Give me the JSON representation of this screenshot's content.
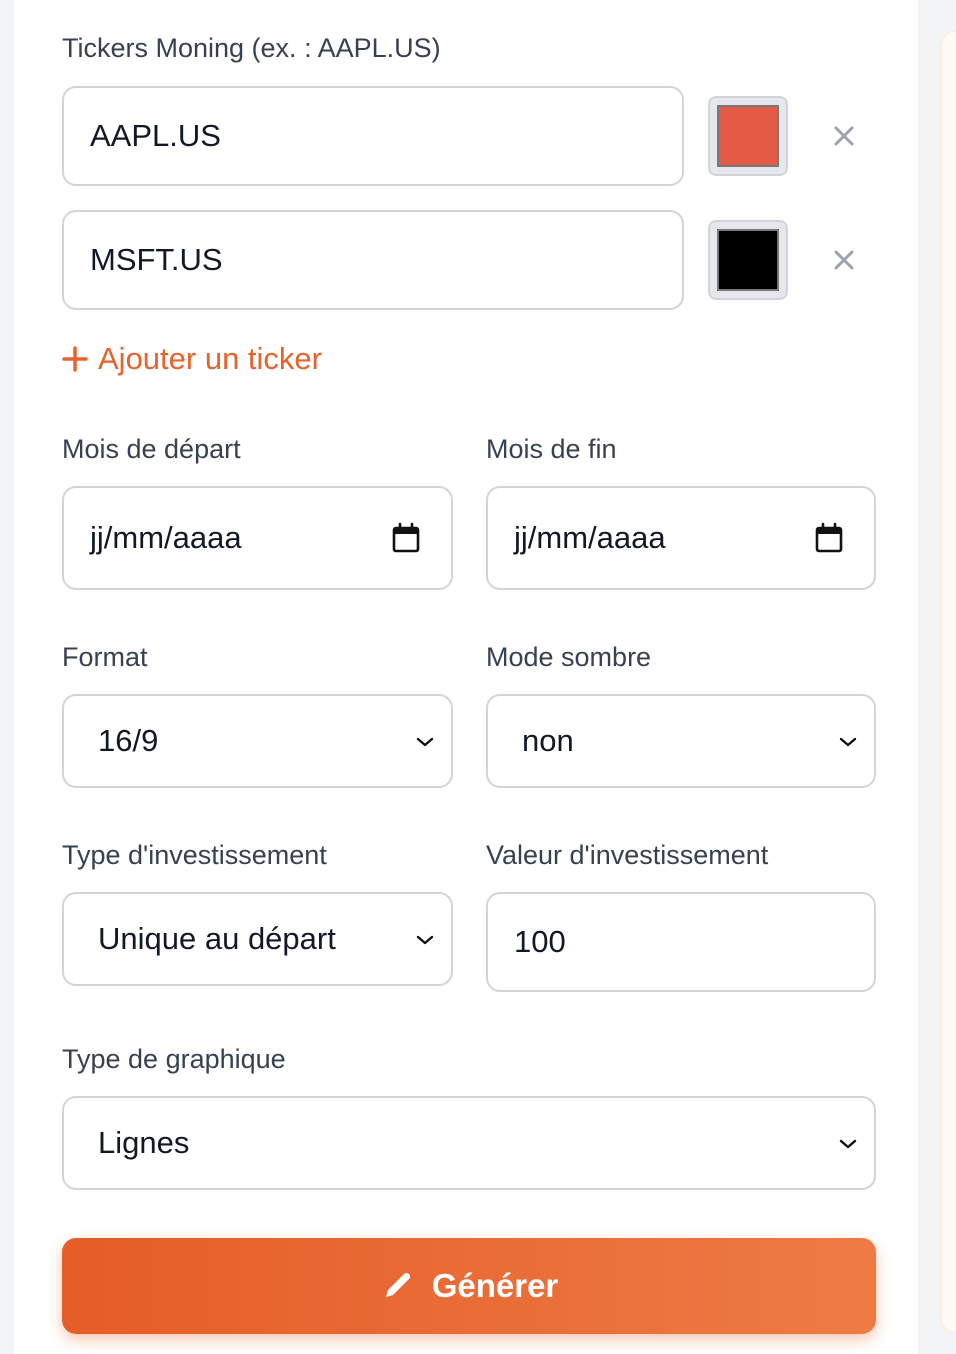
{
  "tickers": {
    "label": "Tickers Moning (ex. : AAPL.US)",
    "items": [
      {
        "value": "AAPL.US",
        "color": "#e45a43"
      },
      {
        "value": "MSFT.US",
        "color": "#000000"
      }
    ],
    "remove_icon": "close-icon",
    "add_label": "Ajouter un ticker",
    "add_icon": "plus-icon"
  },
  "start_month": {
    "label": "Mois de départ",
    "value": "jj/mm/aaaa",
    "icon": "calendar-icon"
  },
  "end_month": {
    "label": "Mois de fin",
    "value": "jj/mm/aaaa",
    "icon": "calendar-icon"
  },
  "format": {
    "label": "Format",
    "value": "16/9"
  },
  "dark_mode": {
    "label": "Mode sombre",
    "value": "non"
  },
  "investment_type": {
    "label": "Type d'investissement",
    "value": "Unique au départ"
  },
  "investment_value": {
    "label": "Valeur d'investissement",
    "value": "100"
  },
  "chart_type": {
    "label": "Type de graphique",
    "value": "Lignes"
  },
  "generate": {
    "label": "Générer",
    "icon": "pencil-icon"
  },
  "colors": {
    "accent": "#e8622c",
    "label_text": "#374151",
    "border": "#d1d5db"
  }
}
